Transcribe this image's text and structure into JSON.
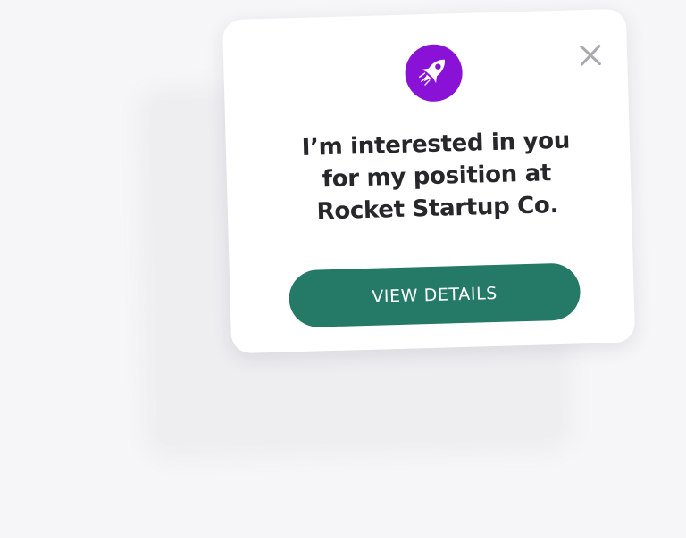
{
  "popup": {
    "logo_icon": "rocket-icon",
    "close_icon": "close-icon",
    "message_lines": [
      "I’m interested in you",
      "for my position at",
      "Rocket Startup Co."
    ],
    "cta_label": "VIEW DETAILS"
  },
  "colors": {
    "background": "#f6f6f8",
    "card": "#ffffff",
    "logo_bg": "#8a12d6",
    "button": "#247a66",
    "button_text": "#ffffff",
    "text": "#26272b",
    "close": "#a8a8ae"
  }
}
